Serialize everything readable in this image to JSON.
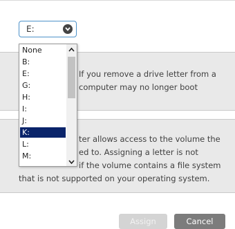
{
  "drive_select": {
    "value": "E:",
    "options": [
      "None",
      "B:",
      "E:",
      "G:",
      "H:",
      "I:",
      "J:",
      "K:",
      "L:",
      "M:"
    ],
    "selected_option": "K:"
  },
  "warning_remove": {
    "line1": "If you remove a drive letter from a",
    "line2": "computer may no longer boot"
  },
  "warning_assign": {
    "line1": "ter allows access to the volume the",
    "line2": "ed to. Assigning a letter is not",
    "line3": "if the volume contains a file system",
    "line4": "that is not supported on your operating system."
  },
  "buttons": {
    "assign": "Assign",
    "cancel": "Cancel"
  },
  "colors": {
    "selected_option_bg": "#0a246a",
    "select_border": "#4c91c9",
    "cancel_bg": "#7c7c7c",
    "assign_bg_disabled": "#d4d4d4"
  }
}
